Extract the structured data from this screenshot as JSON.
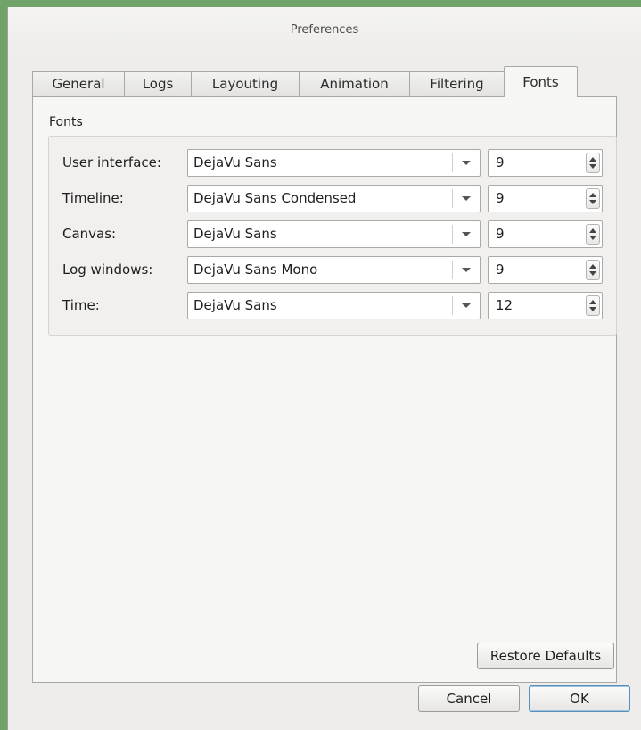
{
  "window": {
    "title": "Preferences"
  },
  "tabs": [
    {
      "label": "General"
    },
    {
      "label": "Logs"
    },
    {
      "label": "Layouting"
    },
    {
      "label": "Animation"
    },
    {
      "label": "Filtering"
    },
    {
      "label": "Fonts",
      "active": true
    }
  ],
  "fonts_group": {
    "title": "Fonts",
    "rows": [
      {
        "label": "User interface:",
        "font": "DejaVu Sans",
        "size": "9"
      },
      {
        "label": "Timeline:",
        "font": "DejaVu Sans Condensed",
        "size": "9"
      },
      {
        "label": "Canvas:",
        "font": "DejaVu Sans",
        "size": "9"
      },
      {
        "label": "Log windows:",
        "font": "DejaVu Sans Mono",
        "size": "9"
      },
      {
        "label": "Time:",
        "font": "DejaVu Sans",
        "size": "12"
      }
    ]
  },
  "buttons": {
    "restore_defaults": "Restore Defaults",
    "cancel": "Cancel",
    "ok": "OK"
  },
  "colors": {
    "desktop": "#6fa36a",
    "window_bg": "#eeedeb",
    "focus_accent": "#5a8fb8"
  }
}
